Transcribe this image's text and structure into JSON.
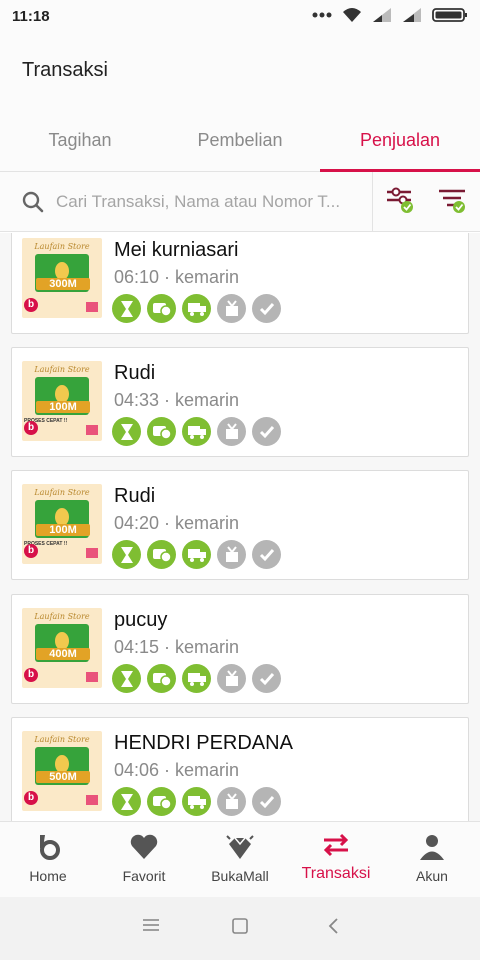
{
  "status_bar": {
    "time": "11:18"
  },
  "header": {
    "title": "Transaksi"
  },
  "tabs": [
    {
      "label": "Tagihan",
      "active": false
    },
    {
      "label": "Pembelian",
      "active": false
    },
    {
      "label": "Penjualan",
      "active": true
    }
  ],
  "search": {
    "placeholder": "Cari Transaksi, Nama atau Nomor T..."
  },
  "store_name": "Laufain Store",
  "transactions": [
    {
      "name": "Mei kurniasari",
      "meta": "06:10 · kemarin",
      "thumb_amount": "300M",
      "thumb_note": ""
    },
    {
      "name": "Rudi",
      "meta": "04:33 · kemarin",
      "thumb_amount": "100M",
      "thumb_note": "PROSES CEPAT !!"
    },
    {
      "name": "Rudi",
      "meta": "04:20 · kemarin",
      "thumb_amount": "100M",
      "thumb_note": "PROSES CEPAT !!"
    },
    {
      "name": "pucuy",
      "meta": "04:15 · kemarin",
      "thumb_amount": "400M",
      "thumb_note": ""
    },
    {
      "name": "HENDRI PERDANA",
      "meta": "04:06 · kemarin",
      "thumb_amount": "500M",
      "thumb_note": ""
    }
  ],
  "status_steps": [
    "hourglass-icon",
    "payment-icon",
    "truck-icon",
    "package-icon",
    "check-icon"
  ],
  "bottom_nav": [
    {
      "label": "Home",
      "icon": "bukalapak-logo-icon",
      "active": false
    },
    {
      "label": "Favorit",
      "icon": "heart-icon",
      "active": false
    },
    {
      "label": "BukaMall",
      "icon": "diamond-icon",
      "active": false
    },
    {
      "label": "Transaksi",
      "icon": "transfer-arrows-icon",
      "active": true
    },
    {
      "label": "Akun",
      "icon": "person-icon",
      "active": false
    }
  ],
  "colors": {
    "accent": "#d71149",
    "step_done": "#7fbe32",
    "step_pending": "#b5b5b5"
  }
}
